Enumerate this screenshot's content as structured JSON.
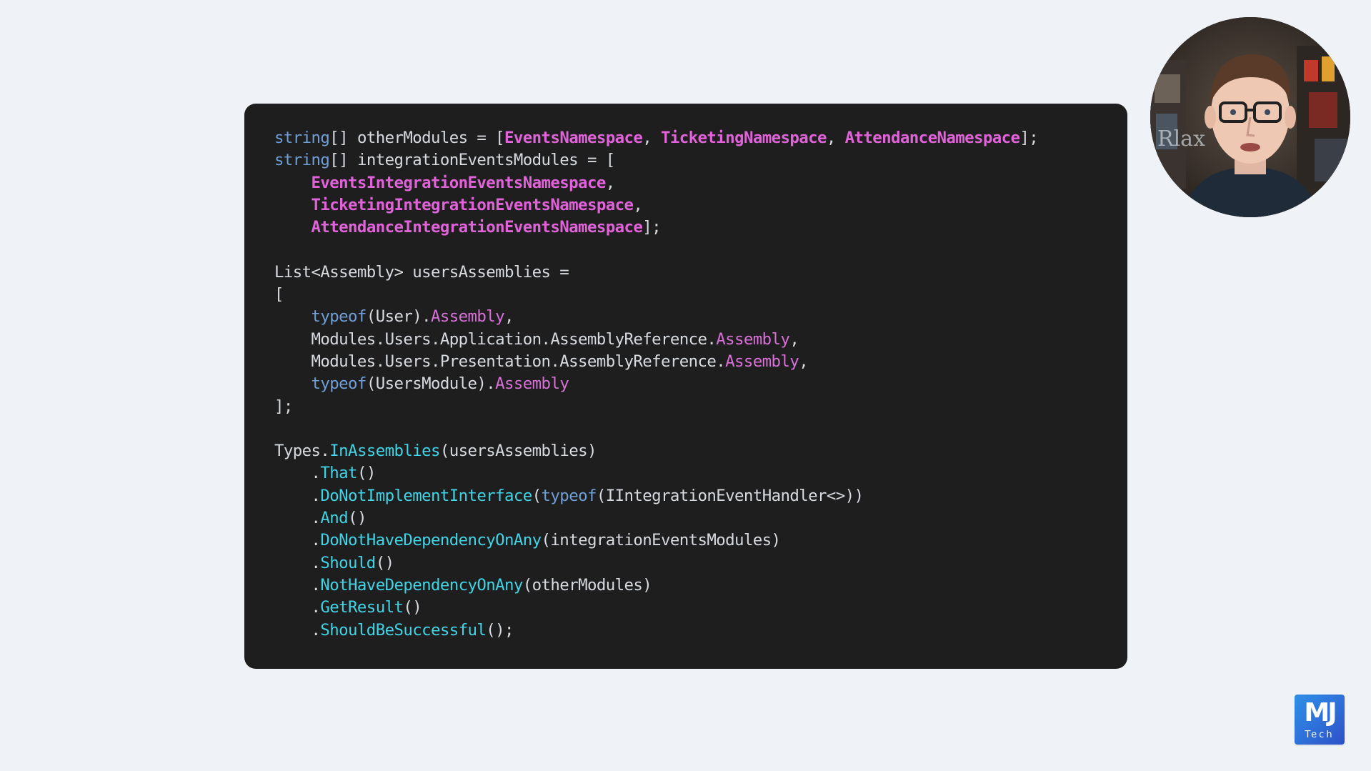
{
  "code": {
    "lines": [
      [
        [
          "kw",
          "string"
        ],
        [
          "txt",
          "[] otherModules = ["
        ],
        [
          "ns",
          "EventsNamespace"
        ],
        [
          "txt",
          ", "
        ],
        [
          "ns",
          "TicketingNamespace"
        ],
        [
          "txt",
          ", "
        ],
        [
          "ns",
          "AttendanceNamespace"
        ],
        [
          "txt",
          "];"
        ]
      ],
      [
        [
          "kw",
          "string"
        ],
        [
          "txt",
          "[] integrationEventsModules = ["
        ]
      ],
      [
        [
          "txt",
          "    "
        ],
        [
          "ns",
          "EventsIntegrationEventsNamespace"
        ],
        [
          "txt",
          ","
        ]
      ],
      [
        [
          "txt",
          "    "
        ],
        [
          "ns",
          "TicketingIntegrationEventsNamespace"
        ],
        [
          "txt",
          ","
        ]
      ],
      [
        [
          "txt",
          "    "
        ],
        [
          "ns",
          "AttendanceIntegrationEventsNamespace"
        ],
        [
          "txt",
          "];"
        ]
      ],
      [],
      [
        [
          "txt",
          "List<Assembly> usersAssemblies ="
        ]
      ],
      [
        [
          "txt",
          "["
        ]
      ],
      [
        [
          "txt",
          "    "
        ],
        [
          "kw",
          "typeof"
        ],
        [
          "txt",
          "(User)."
        ],
        [
          "prop",
          "Assembly"
        ],
        [
          "txt",
          ","
        ]
      ],
      [
        [
          "txt",
          "    Modules.Users.Application.AssemblyReference."
        ],
        [
          "prop",
          "Assembly"
        ],
        [
          "txt",
          ","
        ]
      ],
      [
        [
          "txt",
          "    Modules.Users.Presentation.AssemblyReference."
        ],
        [
          "prop",
          "Assembly"
        ],
        [
          "txt",
          ","
        ]
      ],
      [
        [
          "txt",
          "    "
        ],
        [
          "kw",
          "typeof"
        ],
        [
          "txt",
          "(UsersModule)."
        ],
        [
          "prop",
          "Assembly"
        ]
      ],
      [
        [
          "txt",
          "];"
        ]
      ],
      [],
      [
        [
          "txt",
          "Types."
        ],
        [
          "meth",
          "InAssemblies"
        ],
        [
          "txt",
          "(usersAssemblies)"
        ]
      ],
      [
        [
          "txt",
          "    ."
        ],
        [
          "meth",
          "That"
        ],
        [
          "txt",
          "()"
        ]
      ],
      [
        [
          "txt",
          "    ."
        ],
        [
          "meth",
          "DoNotImplementInterface"
        ],
        [
          "txt",
          "("
        ],
        [
          "kw",
          "typeof"
        ],
        [
          "txt",
          "(IIntegrationEventHandler<>))"
        ]
      ],
      [
        [
          "txt",
          "    ."
        ],
        [
          "meth",
          "And"
        ],
        [
          "txt",
          "()"
        ]
      ],
      [
        [
          "txt",
          "    ."
        ],
        [
          "meth",
          "DoNotHaveDependencyOnAny"
        ],
        [
          "txt",
          "(integrationEventsModules)"
        ]
      ],
      [
        [
          "txt",
          "    ."
        ],
        [
          "meth",
          "Should"
        ],
        [
          "txt",
          "()"
        ]
      ],
      [
        [
          "txt",
          "    ."
        ],
        [
          "meth",
          "NotHaveDependencyOnAny"
        ],
        [
          "txt",
          "(otherModules)"
        ]
      ],
      [
        [
          "txt",
          "    ."
        ],
        [
          "meth",
          "GetResult"
        ],
        [
          "txt",
          "()"
        ]
      ],
      [
        [
          "txt",
          "    ."
        ],
        [
          "meth",
          "ShouldBeSuccessful"
        ],
        [
          "txt",
          "();"
        ]
      ]
    ],
    "colors": {
      "kw": "#6f9fd6",
      "ns": "#e163d9",
      "prop": "#d970d8",
      "meth": "#3fd4e6",
      "txt": "#d7dbe0",
      "background": "#1e1e1e"
    }
  },
  "webcam": {
    "icon": "presenter-avatar"
  },
  "logo": {
    "mark": "MJ",
    "sub": "Tech",
    "color": "#2f6fd8"
  }
}
